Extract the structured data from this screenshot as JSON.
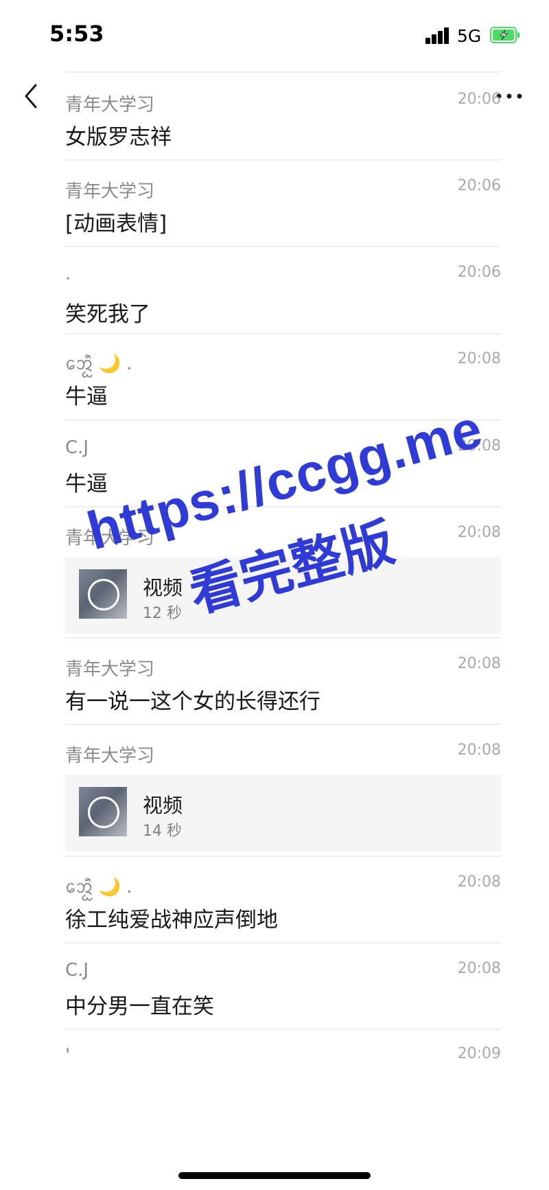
{
  "status_bar": {
    "time": "5:53",
    "network": "5G"
  },
  "messages": [
    {
      "sender": "青年大学习",
      "time": "20:06",
      "text": "女版罗志祥"
    },
    {
      "sender": "青年大学习",
      "time": "20:06",
      "text": "[动画表情]"
    },
    {
      "sender": ".",
      "time": "20:06",
      "text": "笑死我了"
    },
    {
      "sender": "ᩋᩮᩢᩬᩬᩫ",
      "sender_suffix": " .",
      "time": "20:08",
      "text": "牛逼"
    },
    {
      "sender": "C.J",
      "time": "20:08",
      "text": "牛逼"
    },
    {
      "sender": "青年大学习",
      "time": "20:08",
      "video": {
        "title": "视频",
        "duration": "12 秒"
      }
    },
    {
      "sender": "青年大学习",
      "time": "20:08",
      "text": "有一说一这个女的长得还行"
    },
    {
      "sender": "青年大学习",
      "time": "20:08",
      "video": {
        "title": "视频",
        "duration": "14 秒"
      }
    },
    {
      "sender": "ᩋᩮᩢᩬᩬᩫ",
      "sender_suffix": " .",
      "time": "20:08",
      "text": "徐工纯爱战神应声倒地"
    },
    {
      "sender": "C.J",
      "time": "20:08",
      "text": "中分男一直在笑"
    },
    {
      "sender": "'",
      "time": "20:09"
    }
  ],
  "watermark": {
    "line1": "https://ccgg.me",
    "line2": "看完整版",
    "color": "#2f3bd8"
  },
  "icons": {
    "back": "chevron-left-icon",
    "more": "more-dots-icon",
    "moon": "🌙"
  }
}
